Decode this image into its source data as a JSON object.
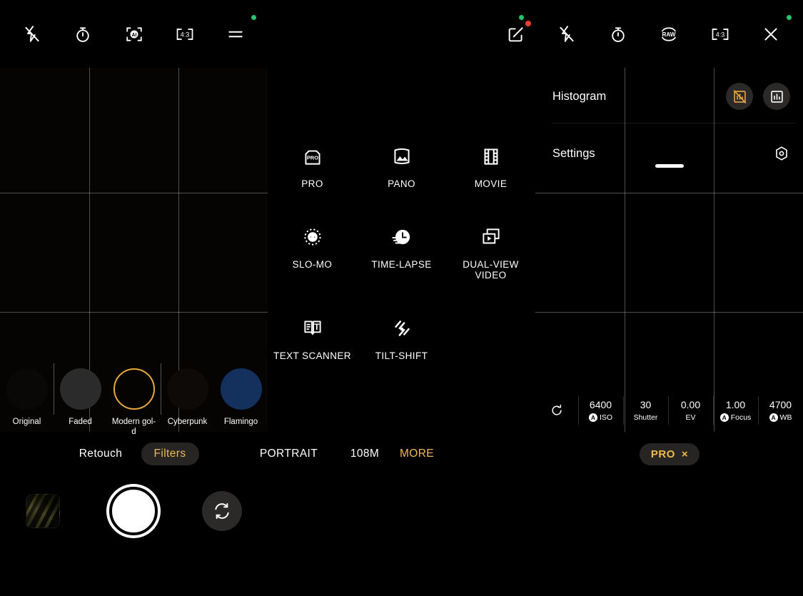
{
  "toolbars": {
    "left": [
      {
        "icon": "flash-off-icon",
        "name": "flash-off-button"
      },
      {
        "icon": "timer-icon",
        "name": "timer-button"
      },
      {
        "icon": "ai-scene-icon",
        "name": "ai-scene-button"
      },
      {
        "icon": "aspect-ratio-icon",
        "name": "aspect-ratio-button",
        "label": "4:3"
      },
      {
        "icon": "menu-icon",
        "name": "menu-button"
      }
    ],
    "right": [
      {
        "icon": "edit-square-icon",
        "name": "edit-button",
        "badge": "red"
      },
      {
        "icon": "flash-off-icon",
        "name": "flash-off-button"
      },
      {
        "icon": "timer-icon",
        "name": "timer-button"
      },
      {
        "icon": "raw-icon",
        "name": "raw-button",
        "label": "RAW"
      },
      {
        "icon": "aspect-ratio-icon",
        "name": "aspect-ratio-button",
        "label": "4:3"
      },
      {
        "icon": "close-icon",
        "name": "close-button"
      }
    ],
    "status_dots": [
      "green",
      "green",
      "red",
      "green"
    ]
  },
  "modes": [
    {
      "label": "PRO",
      "icon": "pro-camera-icon"
    },
    {
      "label": "PANO",
      "icon": "panorama-icon"
    },
    {
      "label": "MOVIE",
      "icon": "film-strip-icon"
    },
    {
      "label": "SLO-MO",
      "icon": "slow-motion-icon"
    },
    {
      "label": "TIME-LAPSE",
      "icon": "time-lapse-clock-icon"
    },
    {
      "label": "DUAL-VIEW VIDEO",
      "icon": "dual-view-video-icon"
    },
    {
      "label": "TEXT SCANNER",
      "icon": "text-scanner-icon"
    },
    {
      "label": "TILT-SHIFT",
      "icon": "tilt-shift-icon"
    }
  ],
  "panel": {
    "histogram": {
      "label": "Histogram",
      "option_off": "histogram-off-icon",
      "option_on": "histogram-on-icon",
      "selected": "off",
      "accent": "#e8a93c"
    },
    "settings": {
      "label": "Settings",
      "icon": "hexagon-gear-icon"
    }
  },
  "pro_controls": {
    "reset_icon": "reset-icon",
    "items": [
      {
        "value": "6400",
        "label": "ISO",
        "auto": true,
        "auto_badge": "A"
      },
      {
        "value": "30",
        "label": "Shutter",
        "auto": false
      },
      {
        "value": "0.00",
        "label": "EV",
        "auto": false
      },
      {
        "value": "1.00",
        "label": "Focus",
        "auto": true,
        "auto_badge": "A"
      },
      {
        "value": "4700",
        "label": "WB",
        "auto": true,
        "auto_badge": "A"
      }
    ]
  },
  "filters": {
    "items": [
      {
        "name": "Original",
        "color": "#0a0806",
        "selected": false
      },
      {
        "name": "Faded",
        "color": "#2b2b2b",
        "selected": false
      },
      {
        "name": "Modern gol-d",
        "color": "#e8a93c",
        "selected": true
      },
      {
        "name": "Cyberpunk",
        "color": "#0d0a08",
        "selected": false
      },
      {
        "name": "Flamingo",
        "color": "#13315c",
        "selected": false
      }
    ]
  },
  "tabs": {
    "retouch": "Retouch",
    "filters": "Filters",
    "portrait": "PORTRAIT",
    "res_108m": "108M",
    "more": "MORE",
    "pro_pill": "PRO",
    "pro_pill_close": "×",
    "accent": "#f0bb4a"
  },
  "bottom": {
    "gallery_thumb": "gallery-thumbnail",
    "shutter": "shutter-button",
    "flip": "switch-camera-icon"
  }
}
